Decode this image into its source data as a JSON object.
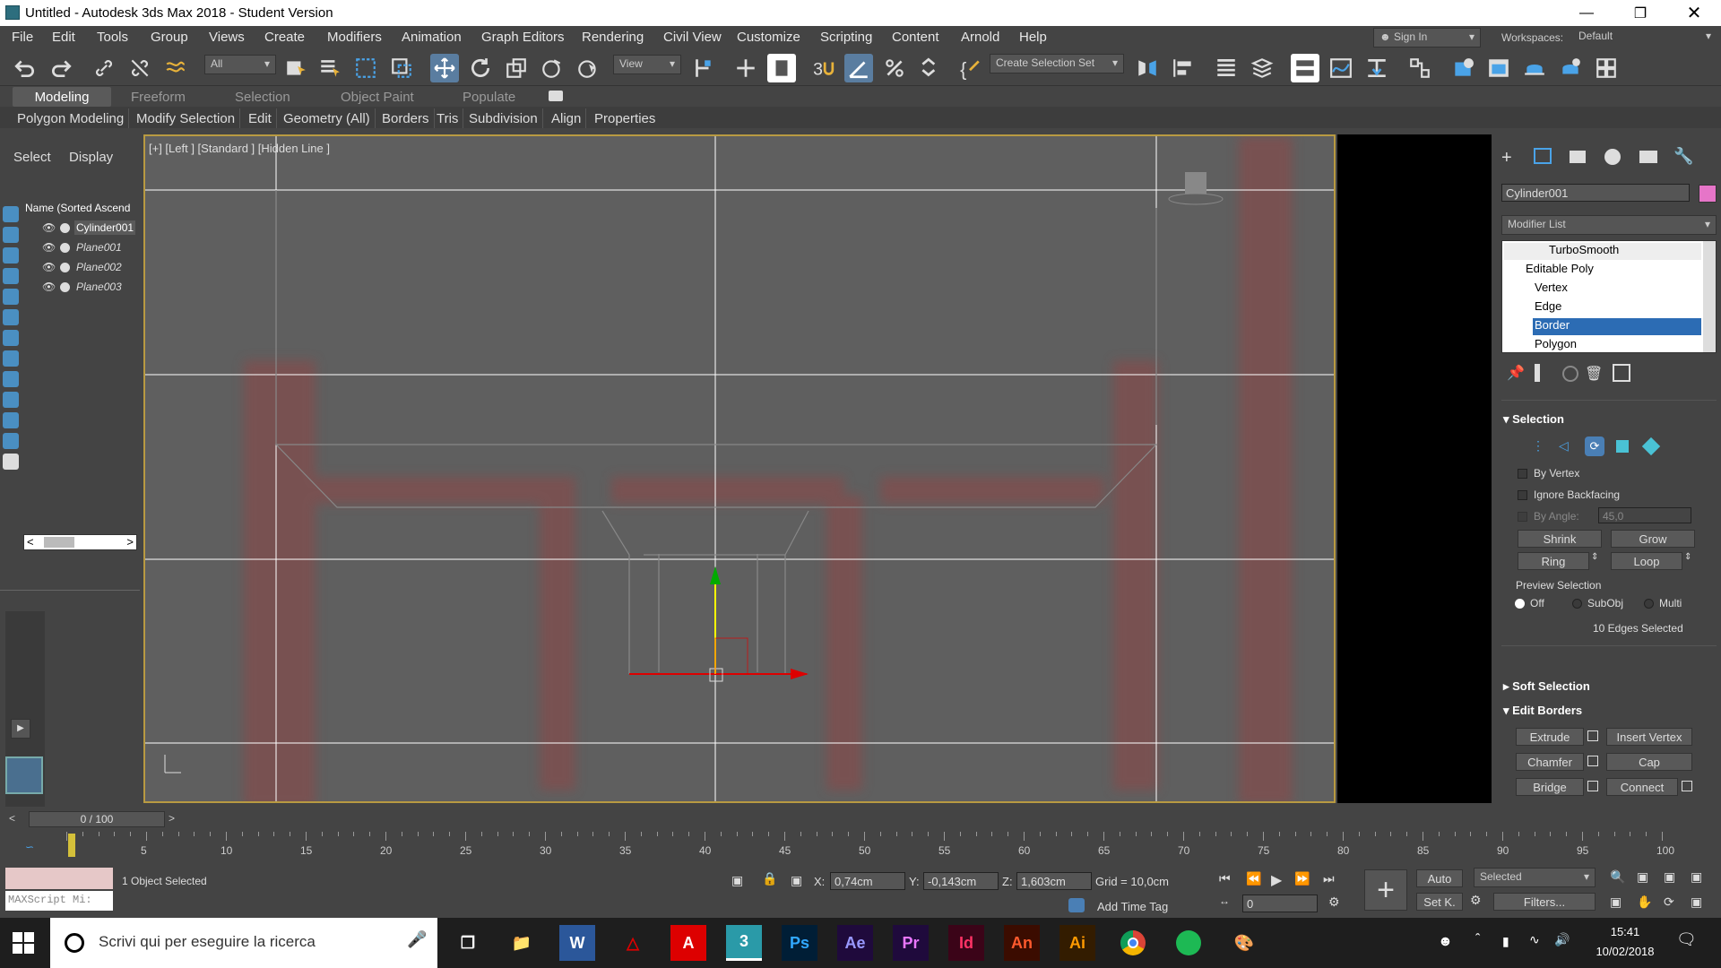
{
  "window": {
    "title": "Untitled - Autodesk 3ds Max 2018 - Student Version"
  },
  "menus": [
    "File",
    "Edit",
    "Tools",
    "Group",
    "Views",
    "Create",
    "Modifiers",
    "Animation",
    "Graph Editors",
    "Rendering",
    "Civil View",
    "Customize",
    "Scripting",
    "Content",
    "Arnold",
    "Help"
  ],
  "account": {
    "sign_in": "Sign In",
    "workspaces_label": "Workspaces:",
    "workspace": "Default"
  },
  "toolbar": {
    "filter": "All",
    "ref_coord": "View",
    "selection_set": "Create Selection Set"
  },
  "ribbon": {
    "tabs": [
      "Modeling",
      "Freeform",
      "Selection",
      "Object Paint",
      "Populate"
    ],
    "buttons": [
      "Polygon Modeling",
      "Modify Selection",
      "Edit",
      "Geometry (All)",
      "Borders",
      "Tris",
      "Subdivision",
      "Align",
      "Properties"
    ]
  },
  "scene_explorer": {
    "tabs": [
      "Select",
      "Display"
    ],
    "column": "Name (Sorted Ascend",
    "items": [
      "Cylinder001",
      "Plane001",
      "Plane002",
      "Plane003"
    ]
  },
  "viewport": {
    "label": "[+] [Left ] [Standard ] [Hidden Line ]"
  },
  "command_panel": {
    "object_name": "Cylinder001",
    "object_color": "#e675c8",
    "modifier_list": "Modifier List",
    "stack": [
      "TurboSmooth",
      "Editable Poly",
      "Vertex",
      "Edge",
      "Border",
      "Polygon"
    ],
    "selection": {
      "title": "Selection",
      "by_vertex": "By Vertex",
      "ignore_backfacing": "Ignore Backfacing",
      "by_angle": "By Angle:",
      "angle": "45,0",
      "shrink": "Shrink",
      "grow": "Grow",
      "ring": "Ring",
      "loop": "Loop",
      "preview": "Preview Selection",
      "off": "Off",
      "subobj": "SubObj",
      "multi": "Multi",
      "status": "10 Edges Selected"
    },
    "soft_selection": "Soft Selection",
    "edit_borders": {
      "title": "Edit Borders",
      "extrude": "Extrude",
      "insert_vertex": "Insert Vertex",
      "chamfer": "Chamfer",
      "cap": "Cap",
      "bridge": "Bridge",
      "connect": "Connect"
    }
  },
  "timeline": {
    "frame": "0 / 100",
    "ticks": [
      "5",
      "10",
      "15",
      "20",
      "25",
      "30",
      "35",
      "40",
      "45",
      "50",
      "55",
      "60",
      "65",
      "70",
      "75",
      "80",
      "85",
      "90",
      "95",
      "100"
    ]
  },
  "status": {
    "maxscript": "MAXScript Mi:",
    "selected": "1 Object Selected",
    "x_label": "X:",
    "x": "0,74cm",
    "y_label": "Y:",
    "y": "-0,143cm",
    "z_label": "Z:",
    "z": "1,603cm",
    "grid": "Grid = 10,0cm",
    "add_time_tag": "Add Time Tag",
    "auto": "Auto",
    "set_key": "Set K.",
    "key_filter": "Selected",
    "filters": "Filters...",
    "frame_field": "0"
  },
  "taskbar": {
    "search": "Scrivi qui per eseguire la ricerca",
    "apps": [
      "Ps",
      "Ae",
      "Pr",
      "Id",
      "An",
      "Ai"
    ],
    "time": "15:41",
    "date": "10/02/2018"
  }
}
